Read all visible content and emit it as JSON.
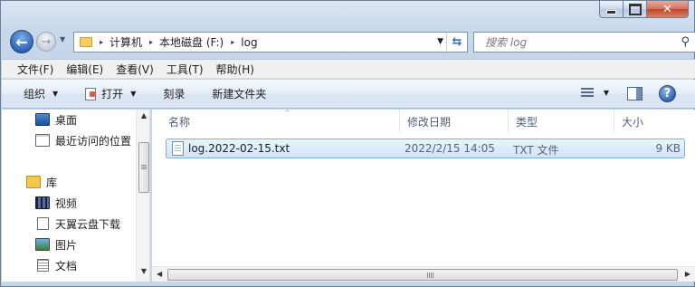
{
  "nav": {
    "back_glyph": "←",
    "forward_glyph": "→",
    "history_glyph": "▼",
    "breadcrumbs": [
      "计算机",
      "本地磁盘 (F:)",
      "log"
    ],
    "crumb_separator": "▸"
  },
  "search": {
    "placeholder": "搜索 log"
  },
  "menu": [
    "文件(F)",
    "编辑(E)",
    "查看(V)",
    "工具(T)",
    "帮助(H)"
  ],
  "toolbar": {
    "organize": "组织",
    "open": "打开",
    "burn": "刻录",
    "new_folder": "新建文件夹",
    "help_glyph": "?"
  },
  "sidebar": {
    "items": [
      {
        "label": "桌面",
        "icon": "desktop-icon"
      },
      {
        "label": "最近访问的位置",
        "icon": "recent-places-icon"
      },
      {
        "label": "库",
        "icon": "library-icon"
      },
      {
        "label": "视频",
        "icon": "video-icon"
      },
      {
        "label": "天翼云盘下载",
        "icon": "document-icon"
      },
      {
        "label": "图片",
        "icon": "picture-icon"
      },
      {
        "label": "文档",
        "icon": "documents-icon"
      }
    ]
  },
  "columns": {
    "name": "名称",
    "modified": "修改日期",
    "type": "类型",
    "size": "大小"
  },
  "files": [
    {
      "name": "log.2022-02-15.txt",
      "modified": "2022/2/15 14:05",
      "type": "TXT 文件",
      "size": "9 KB"
    }
  ],
  "colors": {
    "selection": "#cfe4fa",
    "selection_border": "#84acdd",
    "close_button": "#c0432b"
  }
}
